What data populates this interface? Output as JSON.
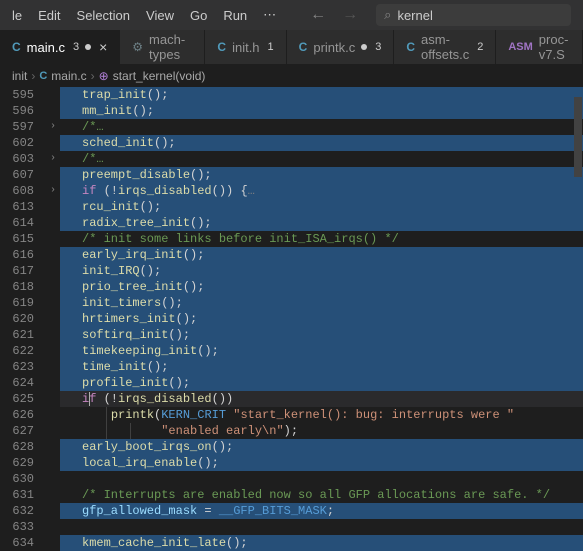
{
  "menu": {
    "items": [
      "le",
      "Edit",
      "Selection",
      "View",
      "Go",
      "Run"
    ],
    "ellipsis": "⋯"
  },
  "search": {
    "value": "kernel"
  },
  "tabs": [
    {
      "icon": "C",
      "iconClass": "c-icon",
      "name": "main.c",
      "badge": "3",
      "dirty": true,
      "active": true,
      "close": true
    },
    {
      "icon": "⚙",
      "iconClass": "g-icon",
      "name": "mach-types",
      "active": false
    },
    {
      "icon": "C",
      "iconClass": "c-icon",
      "name": "init.h",
      "badge": "1",
      "active": false
    },
    {
      "icon": "C",
      "iconClass": "c-icon",
      "name": "printk.c",
      "badge": "3",
      "dirty": true,
      "active": false
    },
    {
      "icon": "C",
      "iconClass": "c-icon",
      "name": "asm-offsets.c",
      "badge": "2",
      "active": false
    },
    {
      "icon": "ASM",
      "iconClass": "asm-icon",
      "name": "proc-v7.S",
      "active": false
    }
  ],
  "breadcrumb": {
    "root": "init",
    "file": "main.c",
    "symbol": "start_kernel(void)"
  },
  "lines": [
    {
      "n": "595",
      "hl": true
    },
    {
      "n": "596",
      "hl": true
    },
    {
      "n": "597",
      "fold": true
    },
    {
      "n": "602",
      "hl": true
    },
    {
      "n": "603",
      "fold": true
    },
    {
      "n": "607",
      "hl": true
    },
    {
      "n": "608",
      "hl": true,
      "fold": true
    },
    {
      "n": "613",
      "hl": true
    },
    {
      "n": "614",
      "hl": true
    },
    {
      "n": "615"
    },
    {
      "n": "616",
      "hl": true
    },
    {
      "n": "617",
      "hl": true
    },
    {
      "n": "618",
      "hl": true
    },
    {
      "n": "619",
      "hl": true
    },
    {
      "n": "620",
      "hl": true
    },
    {
      "n": "621",
      "hl": true
    },
    {
      "n": "622",
      "hl": true
    },
    {
      "n": "623",
      "hl": true
    },
    {
      "n": "624",
      "hl": true
    },
    {
      "n": "625",
      "hl": true,
      "cursor": true
    },
    {
      "n": "626"
    },
    {
      "n": "627"
    },
    {
      "n": "628",
      "hl": true
    },
    {
      "n": "629",
      "hl": true
    },
    {
      "n": "630"
    },
    {
      "n": "631"
    },
    {
      "n": "632",
      "hl": true
    },
    {
      "n": "633"
    },
    {
      "n": "634",
      "hl": true
    }
  ],
  "code": {
    "l595": {
      "fn": "trap_init",
      "p": "();"
    },
    "l596": {
      "fn": "mm_init",
      "p": "();"
    },
    "l597": {
      "cm": "/*…"
    },
    "l602": {
      "fn": "sched_init",
      "p": "();"
    },
    "l603": {
      "cm": "/*…"
    },
    "l607": {
      "fn": "preempt_disable",
      "p": "();"
    },
    "l608": {
      "kw": "if",
      "op1": " (!",
      "fn": "irqs_disabled",
      "op2": "()) {",
      "fold": "…"
    },
    "l613": {
      "fn": "rcu_init",
      "p": "();"
    },
    "l614": {
      "fn": "radix_tree_init",
      "p": "();"
    },
    "l615": {
      "cm": "/* init some links before init_ISA_irqs() */"
    },
    "l616": {
      "fn": "early_irq_init",
      "p": "();"
    },
    "l617": {
      "fn": "init_IRQ",
      "p": "();"
    },
    "l618": {
      "fn": "prio_tree_init",
      "p": "();"
    },
    "l619": {
      "fn": "init_timers",
      "p": "();"
    },
    "l620": {
      "fn": "hrtimers_init",
      "p": "();"
    },
    "l621": {
      "fn": "softirq_init",
      "p": "();"
    },
    "l622": {
      "fn": "timekeeping_init",
      "p": "();"
    },
    "l623": {
      "fn": "time_init",
      "p": "();"
    },
    "l624": {
      "fn": "profile_init",
      "p": "();"
    },
    "l625": {
      "kw1": "i",
      "kw2": "f",
      "op1": " (!",
      "fn": "irqs_disabled",
      "op2": "())"
    },
    "l626": {
      "fn": "printk",
      "op1": "(",
      "mc": "KERN_CRIT",
      "sp": " ",
      "st": "\"start_kernel(): bug: interrupts were \""
    },
    "l627": {
      "st": "\"enabled early\\n\"",
      "op": ");"
    },
    "l628": {
      "fn": "early_boot_irqs_on",
      "p": "();"
    },
    "l629": {
      "fn": "local_irq_enable",
      "p": "();"
    },
    "l631": {
      "cm": "/* Interrupts are enabled now so all GFP allocations are safe. */"
    },
    "l632": {
      "va": "gfp_allowed_mask",
      "op": " = ",
      "mc": "__GFP_BITS_MASK",
      "p": ";"
    },
    "l634": {
      "fn": "kmem_cache_init_late",
      "p": "();"
    }
  }
}
